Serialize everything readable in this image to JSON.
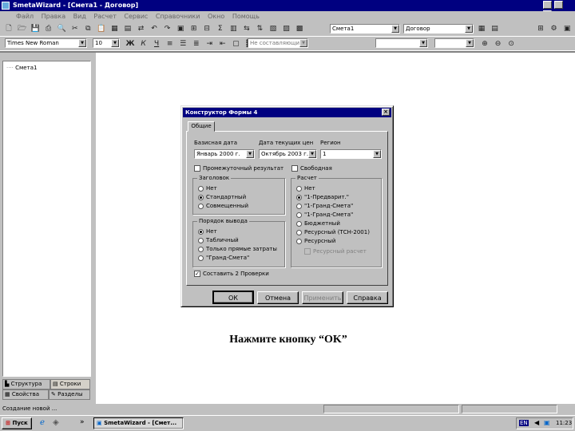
{
  "app": {
    "title": "SmetaWizard - [Смета1 - Договор]",
    "win_controls": [
      "_",
      "□",
      "×"
    ]
  },
  "menu": {
    "items": [
      "Файл",
      "Правка",
      "Вид",
      "Расчет",
      "Сервис",
      "Справочники",
      "Окно",
      "Помощь"
    ]
  },
  "toolbar": {
    "doc_combo": "Смета1",
    "type_combo": "Договор"
  },
  "format_bar": {
    "font": "Times New Roman",
    "size": "10",
    "bold": "Ж",
    "italic": "К",
    "underline": "Ч",
    "style_combo": "Не составляющие"
  },
  "tree": {
    "root": "Смета1"
  },
  "left_tabs": {
    "tab1": "Структура",
    "tab2": "Строки",
    "tab3": "Свойства",
    "tab4": "Разделы"
  },
  "dialog": {
    "title": "Конструктор Формы 4",
    "tab": "Общие",
    "base_label": "Базисная дата",
    "current_label": "Дата текущих цен",
    "region_label": "Регион",
    "base_value": "Январь 2000 г.",
    "current_value": "Октябрь 2003 г.",
    "region_value": "1",
    "project_cost": "Промежуточный результат",
    "free": "Свободная",
    "header_group": "Заголовок",
    "header_opts": [
      "Нет",
      "Стандартный",
      "Совмещенный"
    ],
    "costs_group": "Порядок вывода",
    "costs_opts": [
      "Нет",
      "Табличный",
      "Только прямые затраты",
      "\"Гранд-Смета\""
    ],
    "calc_group": "Расчет",
    "calc_opts": [
      "Нет",
      "\"1-Предварит.\"",
      "\"1-Гранд-Смета\"",
      "\"1-Гранд-Смета\"",
      "Бюджетный",
      "Ресурсный (ТСН-2001)",
      "Ресурсный"
    ],
    "calc_check": "Ресурсный расчет",
    "bottom_check": "Составить 2 Проверки",
    "ok": "ОК",
    "cancel": "Отмена",
    "apply": "Применить",
    "help": "Справка"
  },
  "caption": "Нажмите кнопку “OK”",
  "status": {
    "text": "Создание новой ..."
  },
  "taskbar": {
    "start": "Пуск",
    "task": "SmetaWizard - [Смет...",
    "lang": "EN",
    "time": "11:23"
  },
  "colors": {
    "titlebar": "#000080",
    "face": "#c0c0c0"
  }
}
